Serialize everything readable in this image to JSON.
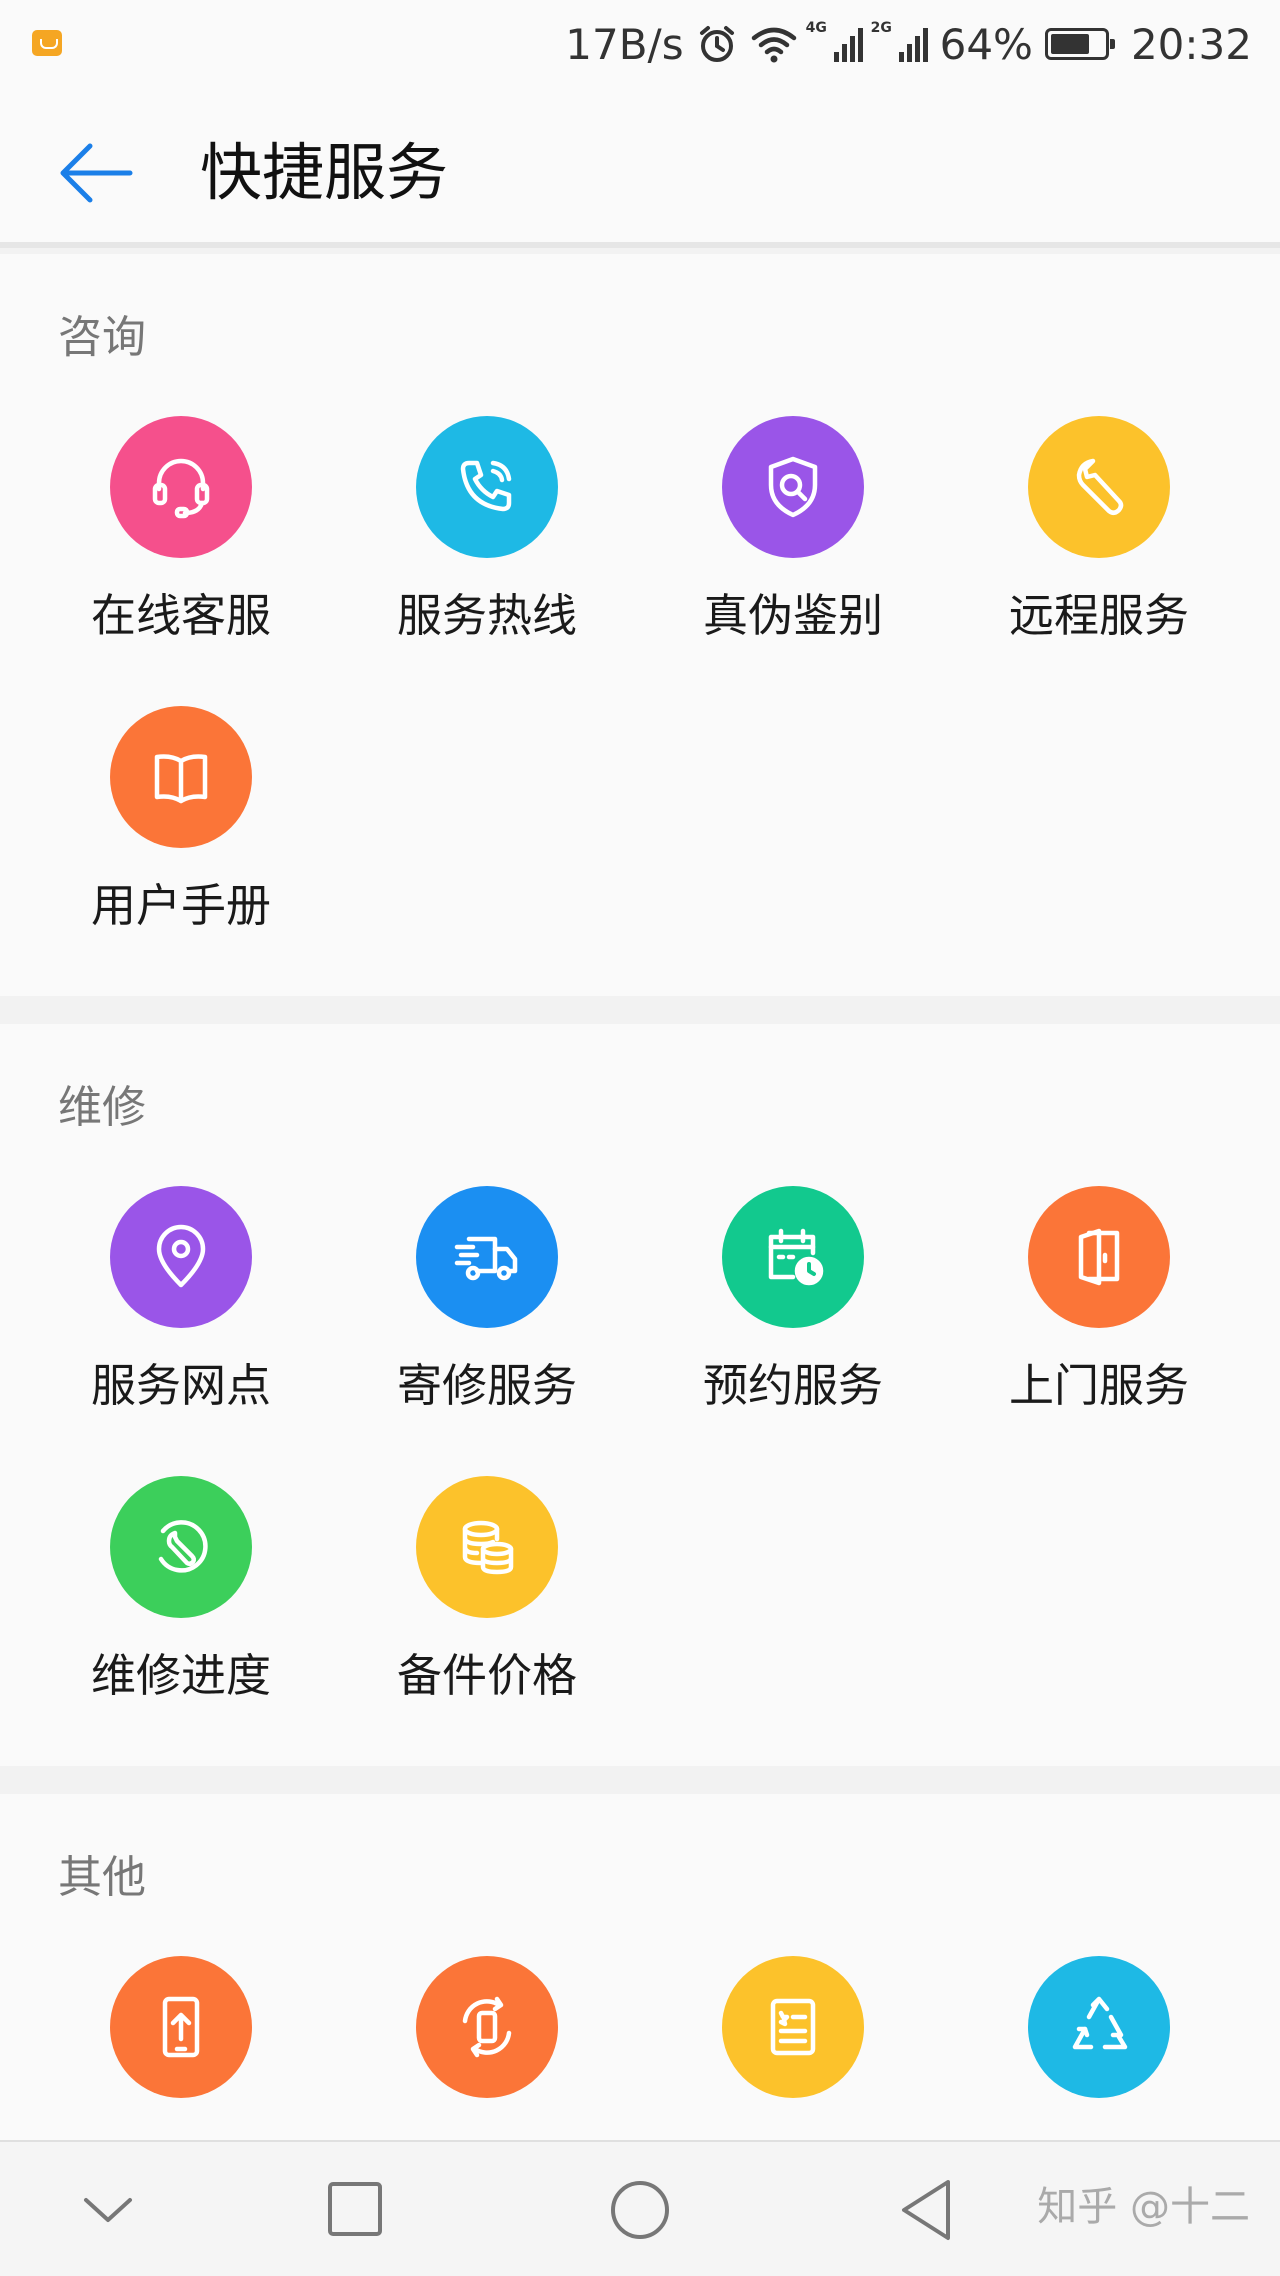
{
  "status_bar": {
    "speed": "17B/s",
    "net1": "4G",
    "net2": "2G",
    "battery": "64%",
    "time": "20:32"
  },
  "header": {
    "title": "快捷服务"
  },
  "sections": [
    {
      "title": "咨询",
      "items": [
        {
          "label": "在线客服",
          "icon": "headset-icon",
          "color": "#f5508c"
        },
        {
          "label": "服务热线",
          "icon": "phone-call-icon",
          "color": "#1eb9e5"
        },
        {
          "label": "真伪鉴别",
          "icon": "shield-search-icon",
          "color": "#9a55e8"
        },
        {
          "label": "远程服务",
          "icon": "wrench-icon",
          "color": "#fcc22b"
        },
        {
          "label": "用户手册",
          "icon": "book-icon",
          "color": "#fb7538"
        }
      ]
    },
    {
      "title": "维修",
      "items": [
        {
          "label": "服务网点",
          "icon": "location-pin-icon",
          "color": "#9a55e8"
        },
        {
          "label": "寄修服务",
          "icon": "truck-icon",
          "color": "#1b8ff2"
        },
        {
          "label": "预约服务",
          "icon": "calendar-clock-icon",
          "color": "#12c98e"
        },
        {
          "label": "上门服务",
          "icon": "door-icon",
          "color": "#fb7538"
        },
        {
          "label": "维修进度",
          "icon": "repair-progress-icon",
          "color": "#3ccf5b"
        },
        {
          "label": "备件价格",
          "icon": "coins-icon",
          "color": "#fcc22b"
        }
      ]
    },
    {
      "title": "其他",
      "items": [
        {
          "label": "",
          "icon": "phone-upload-icon",
          "color": "#fb7538"
        },
        {
          "label": "",
          "icon": "phone-rotate-icon",
          "color": "#fb7538"
        },
        {
          "label": "",
          "icon": "document-icon",
          "color": "#fcc22b"
        },
        {
          "label": "",
          "icon": "recycle-icon",
          "color": "#1eb9e5"
        }
      ]
    }
  ],
  "nav_bar": {
    "buttons": [
      "collapse-icon",
      "recents-icon",
      "home-icon",
      "back-icon"
    ]
  },
  "watermark": "知乎 @十二"
}
